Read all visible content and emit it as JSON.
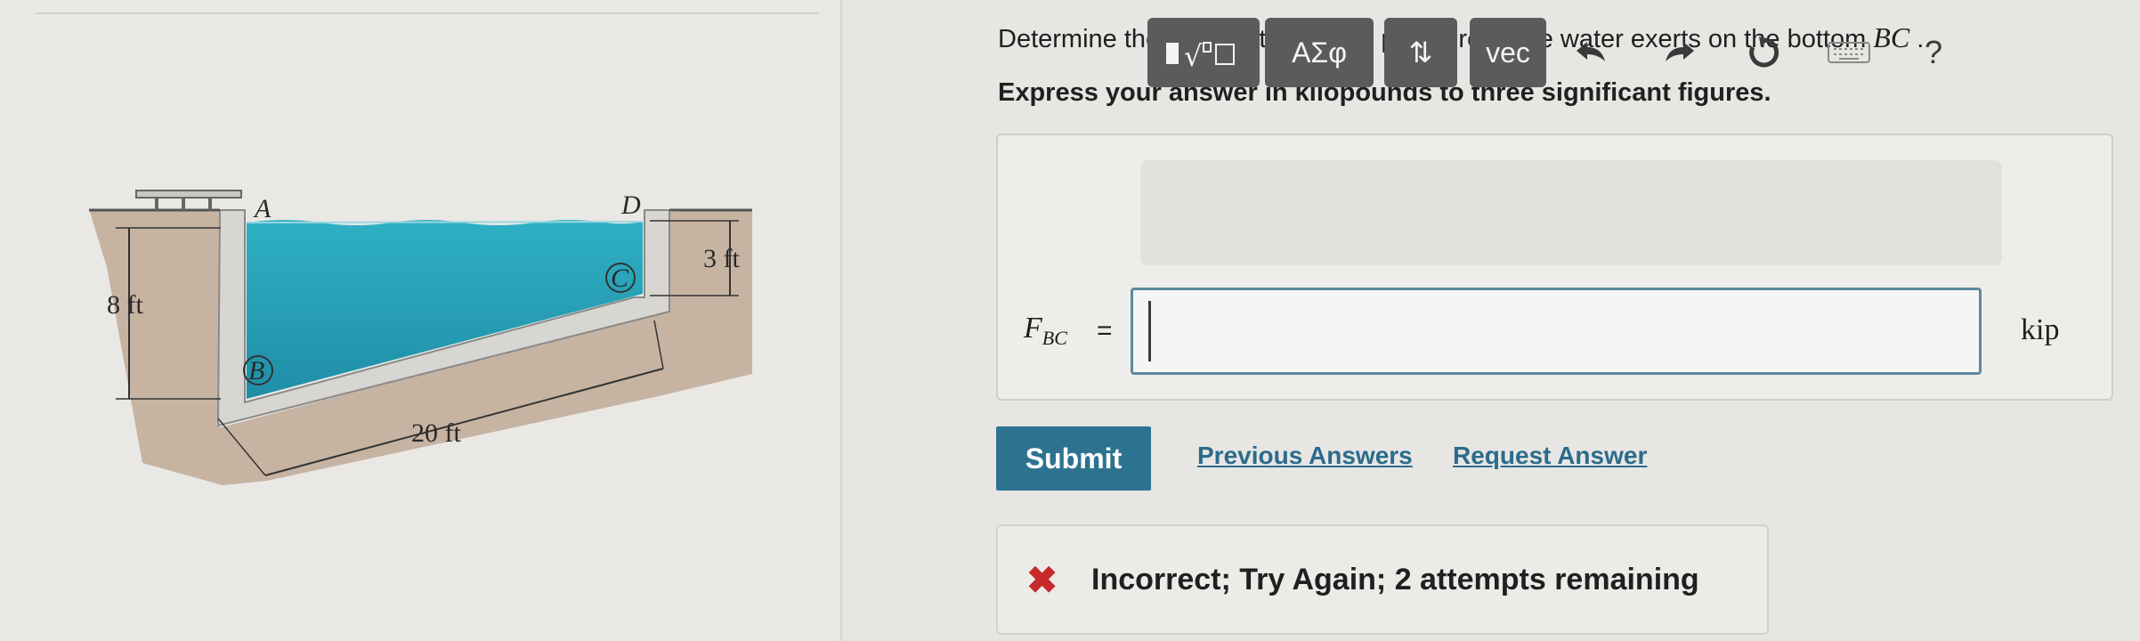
{
  "figure": {
    "labels": {
      "point_a": "A",
      "point_b": "B",
      "point_c": "C",
      "point_d": "D",
      "height_left": "8 ft",
      "height_right": "3 ft",
      "length_bottom": "20 ft"
    }
  },
  "question": {
    "text_before": "Determine the resultant force the pressure of the water exerts on the bottom ",
    "math_segment": "BC",
    "text_after": " ."
  },
  "instruction": "Express your answer in kilopounds to three significant figures.",
  "toolbar": {
    "templates_icon": "templates-icon",
    "greek_label": "ΑΣφ",
    "arrows_label": "⇅",
    "vec_label": "vec",
    "undo_icon": "undo-icon",
    "redo_icon": "redo-icon",
    "reset_icon": "reset-icon",
    "keyboard_icon": "keyboard-icon",
    "help_label": "?"
  },
  "answer": {
    "variable": "F",
    "subscript": "BC",
    "equals": "=",
    "value": "",
    "unit": "kip"
  },
  "actions": {
    "submit_label": "Submit",
    "previous_answers_label": "Previous Answers",
    "request_answer_label": "Request Answer"
  },
  "feedback": {
    "icon": "x-icon",
    "text": "Incorrect; Try Again; 2 attempts remaining"
  },
  "colors": {
    "water": "#2fa8be",
    "submit": "#2d7390",
    "link": "#2c6b8c",
    "error": "#c8292b",
    "input_border": "#5a8a9c"
  }
}
